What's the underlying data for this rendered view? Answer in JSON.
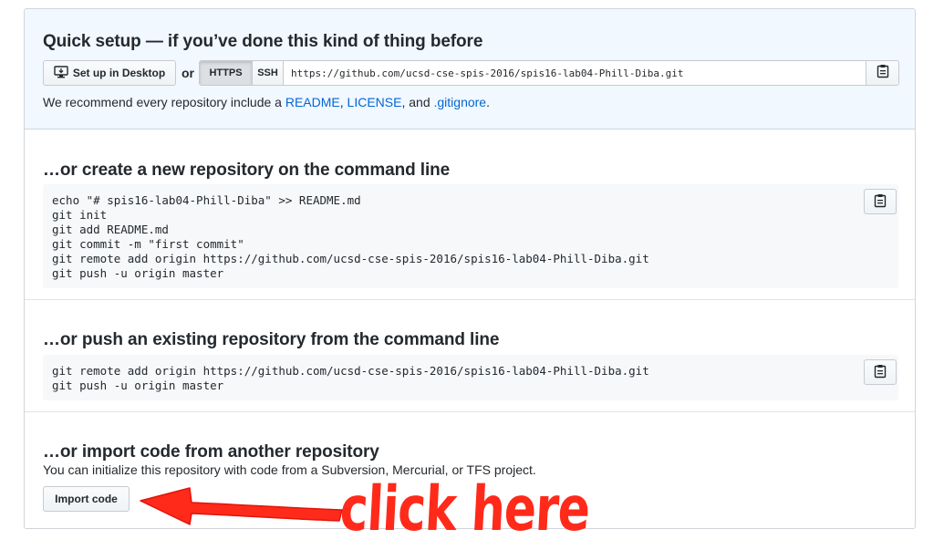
{
  "quick_setup": {
    "title": "Quick setup — if you’ve done this kind of thing before",
    "desktop_button": "Set up in Desktop",
    "or_label": "or",
    "https_label": "HTTPS",
    "ssh_label": "SSH",
    "clone_url": "https://github.com/ucsd-cse-spis-2016/spis16-lab04-Phill-Diba.git",
    "recommend_prefix": "We recommend every repository include a ",
    "readme_link": "README",
    "sep1": ", ",
    "license_link": "LICENSE",
    "sep2": ", and ",
    "gitignore_link": ".gitignore",
    "recommend_suffix": "."
  },
  "new_repo": {
    "title": "…or create a new repository on the command line",
    "code": "echo \"# spis16-lab04-Phill-Diba\" >> README.md\ngit init\ngit add README.md\ngit commit -m \"first commit\"\ngit remote add origin https://github.com/ucsd-cse-spis-2016/spis16-lab04-Phill-Diba.git\ngit push -u origin master"
  },
  "push_repo": {
    "title": "…or push an existing repository from the command line",
    "code": "git remote add origin https://github.com/ucsd-cse-spis-2016/spis16-lab04-Phill-Diba.git\ngit push -u origin master"
  },
  "import_repo": {
    "title": "…or import code from another repository",
    "description": "You can initialize this repository with code from a Subversion, Mercurial, or TFS project.",
    "button": "Import code"
  },
  "annotation": {
    "text": "click here",
    "color": "#ff2a1a"
  },
  "icons": {
    "desktop": "desktop-icon",
    "clipboard": "clipboard-icon"
  },
  "colors": {
    "link": "#0366d6",
    "quick_setup_bg": "#f1f8ff",
    "code_bg": "#f6f8fa"
  }
}
